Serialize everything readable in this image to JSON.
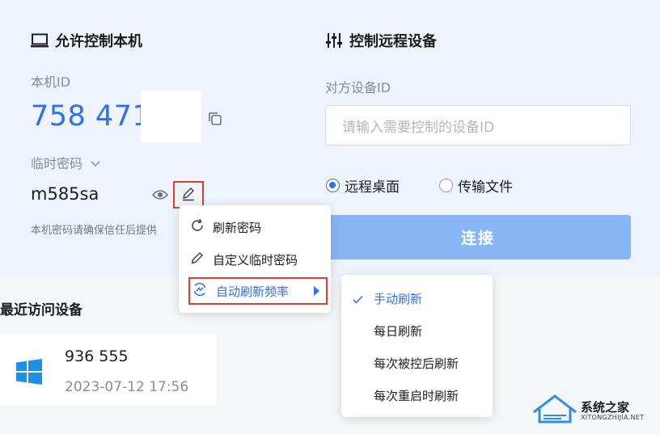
{
  "local": {
    "title": "允许控制本机",
    "id_label": "本机ID",
    "device_id": "758 471",
    "password_label": "临时密码",
    "password": "m585sa",
    "hint": "本机密码请确保信任后提供"
  },
  "remote": {
    "title": "控制远程设备",
    "target_label": "对方设备ID",
    "input_placeholder": "请输入需要控制的设备ID",
    "radio_desktop": "远程桌面",
    "radio_file": "传输文件",
    "selected_mode": "远程桌面",
    "connect_label": "连接"
  },
  "recent": {
    "title": "最近访问设备",
    "device_id": "936 555",
    "datetime": "2023-07-12 17:56"
  },
  "password_menu": {
    "items": [
      "刷新密码",
      "自定义临时密码",
      "自动刷新频率"
    ]
  },
  "refresh_submenu": {
    "items": [
      "手动刷新",
      "每日刷新",
      "每次被控后刷新",
      "每次重启时刷新"
    ],
    "selected": "手动刷新"
  },
  "watermark": {
    "text": "系统之家",
    "url": "XITONGZHIJIA.NET"
  },
  "colors": {
    "accent": "#2f6ff0",
    "highlight_box": "#e53a2d",
    "connect_button": "#87b5f5"
  }
}
